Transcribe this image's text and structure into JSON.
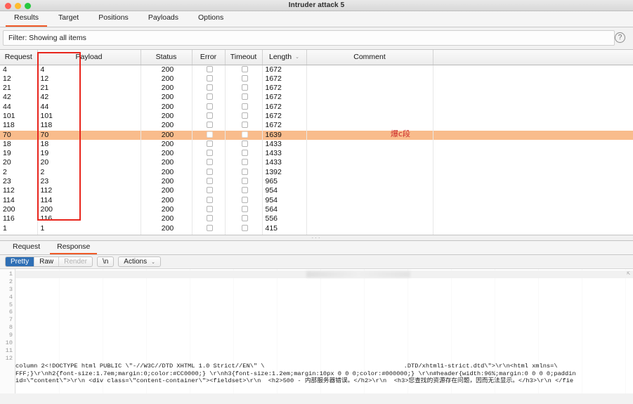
{
  "window": {
    "title": "Intruder attack 5",
    "controls": [
      "close",
      "minimize",
      "zoom"
    ]
  },
  "tabs": [
    {
      "label": "Results",
      "active": true
    },
    {
      "label": "Target",
      "active": false
    },
    {
      "label": "Positions",
      "active": false
    },
    {
      "label": "Payloads",
      "active": false
    },
    {
      "label": "Options",
      "active": false
    }
  ],
  "filter": {
    "text": "Filter: Showing all items",
    "help_icon": "question-mark-icon"
  },
  "results_table": {
    "columns": [
      "Request",
      "Payload",
      "Status",
      "Error",
      "Timeout",
      "Length",
      "Comment",
      ""
    ],
    "sorted_column": "Length",
    "sort_caret": "⌄",
    "rows": [
      {
        "request": "4",
        "payload": "4",
        "status": "200",
        "error": false,
        "timeout": false,
        "length": "1672",
        "comment": "",
        "highlight": false
      },
      {
        "request": "12",
        "payload": "12",
        "status": "200",
        "error": false,
        "timeout": false,
        "length": "1672",
        "comment": "",
        "highlight": false
      },
      {
        "request": "21",
        "payload": "21",
        "status": "200",
        "error": false,
        "timeout": false,
        "length": "1672",
        "comment": "",
        "highlight": false
      },
      {
        "request": "42",
        "payload": "42",
        "status": "200",
        "error": false,
        "timeout": false,
        "length": "1672",
        "comment": "",
        "highlight": false
      },
      {
        "request": "44",
        "payload": "44",
        "status": "200",
        "error": false,
        "timeout": false,
        "length": "1672",
        "comment": "",
        "highlight": false
      },
      {
        "request": "101",
        "payload": "101",
        "status": "200",
        "error": false,
        "timeout": false,
        "length": "1672",
        "comment": "",
        "highlight": false
      },
      {
        "request": "118",
        "payload": "118",
        "status": "200",
        "error": false,
        "timeout": false,
        "length": "1672",
        "comment": "",
        "highlight": false
      },
      {
        "request": "70",
        "payload": "70",
        "status": "200",
        "error": false,
        "timeout": false,
        "length": "1639",
        "comment": "",
        "highlight": true
      },
      {
        "request": "18",
        "payload": "18",
        "status": "200",
        "error": false,
        "timeout": false,
        "length": "1433",
        "comment": "",
        "highlight": false
      },
      {
        "request": "19",
        "payload": "19",
        "status": "200",
        "error": false,
        "timeout": false,
        "length": "1433",
        "comment": "",
        "highlight": false
      },
      {
        "request": "20",
        "payload": "20",
        "status": "200",
        "error": false,
        "timeout": false,
        "length": "1433",
        "comment": "",
        "highlight": false
      },
      {
        "request": "2",
        "payload": "2",
        "status": "200",
        "error": false,
        "timeout": false,
        "length": "1392",
        "comment": "",
        "highlight": false
      },
      {
        "request": "23",
        "payload": "23",
        "status": "200",
        "error": false,
        "timeout": false,
        "length": "965",
        "comment": "",
        "highlight": false
      },
      {
        "request": "112",
        "payload": "112",
        "status": "200",
        "error": false,
        "timeout": false,
        "length": "954",
        "comment": "",
        "highlight": false
      },
      {
        "request": "114",
        "payload": "114",
        "status": "200",
        "error": false,
        "timeout": false,
        "length": "954",
        "comment": "",
        "highlight": false
      },
      {
        "request": "200",
        "payload": "200",
        "status": "200",
        "error": false,
        "timeout": false,
        "length": "564",
        "comment": "",
        "highlight": false
      },
      {
        "request": "116",
        "payload": "116",
        "status": "200",
        "error": false,
        "timeout": false,
        "length": "556",
        "comment": "",
        "highlight": false
      },
      {
        "request": "1",
        "payload": "1",
        "status": "200",
        "error": false,
        "timeout": false,
        "length": "415",
        "comment": "",
        "highlight": false
      }
    ]
  },
  "annotations": {
    "payload_column_box_color": "#e8251c",
    "note_text": "爆c段",
    "note_color": "#cc2a2a"
  },
  "splitter": {
    "grip": "···"
  },
  "detail_tabs": [
    {
      "label": "Request",
      "active": false
    },
    {
      "label": "Response",
      "active": true
    }
  ],
  "view_toolbar": {
    "segments": [
      {
        "label": "Pretty",
        "state": "selected"
      },
      {
        "label": "Raw",
        "state": "normal"
      },
      {
        "label": "Render",
        "state": "disabled"
      }
    ],
    "newline_button": "\\n",
    "actions_button": "Actions",
    "actions_caret": "⌄"
  },
  "editor": {
    "line_numbers": [
      "1",
      "2",
      "3",
      "4",
      "5",
      "6",
      "7",
      "8",
      "9",
      "10",
      "11",
      "12"
    ],
    "source_lines": [
      "column 2<!DOCTYPE html PUBLIC \\\"-//W3C//DTD XHTML 1.0 Strict//EN\\\" \\                                      .DTD/xhtml1-strict.dtd\\\">\\r\\n<html xmlns=\\",
      "FFF;}\\r\\nh2{font-size:1.7em;margin:0;color:#CC0000;} \\r\\nh3{font-size:1.2em;margin:10px 0 0 0;color:#000000;} \\r\\n#header{width:96%;margin:0 0 0 0;paddin",
      "id=\\\"content\\\">\\r\\n <div class=\\\"content-container\\\"><fieldset>\\r\\n  <h2>500 - 内部服务器错误。</h2>\\r\\n  <h3>您查找的资源存在问题，因而无法显示。</h3>\\r\\n </fie"
    ]
  }
}
